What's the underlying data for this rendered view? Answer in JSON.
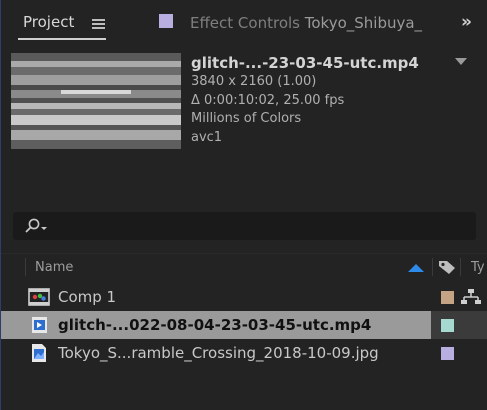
{
  "tabs": {
    "project": "Project",
    "effect_controls": "Effect Controls",
    "effect_controls_target": "Tokyo_Shibuya_",
    "effect_controls_color": "#b8aee0"
  },
  "preview": {
    "filename": "glitch-...-23-03-45-utc.mp4",
    "resolution": "3840 x 2160 (1.00)",
    "duration": "Δ 0:00:10:02, 25.00 fps",
    "colors": "Millions of Colors",
    "codec": "avc1"
  },
  "search": {
    "value": "",
    "placeholder": ""
  },
  "columns": {
    "name": "Name",
    "type": "Ty"
  },
  "items": [
    {
      "name": "Comp 1",
      "icon": "composition-icon",
      "label_color": "#c4a484"
    },
    {
      "name": "glitch-...022-08-04-23-03-45-utc.mp4",
      "icon": "video-footage-icon",
      "label_color": "#a6d9d0",
      "selected": true
    },
    {
      "name": "Tokyo_S...ramble_Crossing_2018-10-09.jpg",
      "icon": "image-file-icon",
      "label_color": "#b8aee0"
    }
  ],
  "colors": {
    "accent": "#2d8ceb",
    "panel_bg": "#232323",
    "selection": "#9a9a9a"
  }
}
